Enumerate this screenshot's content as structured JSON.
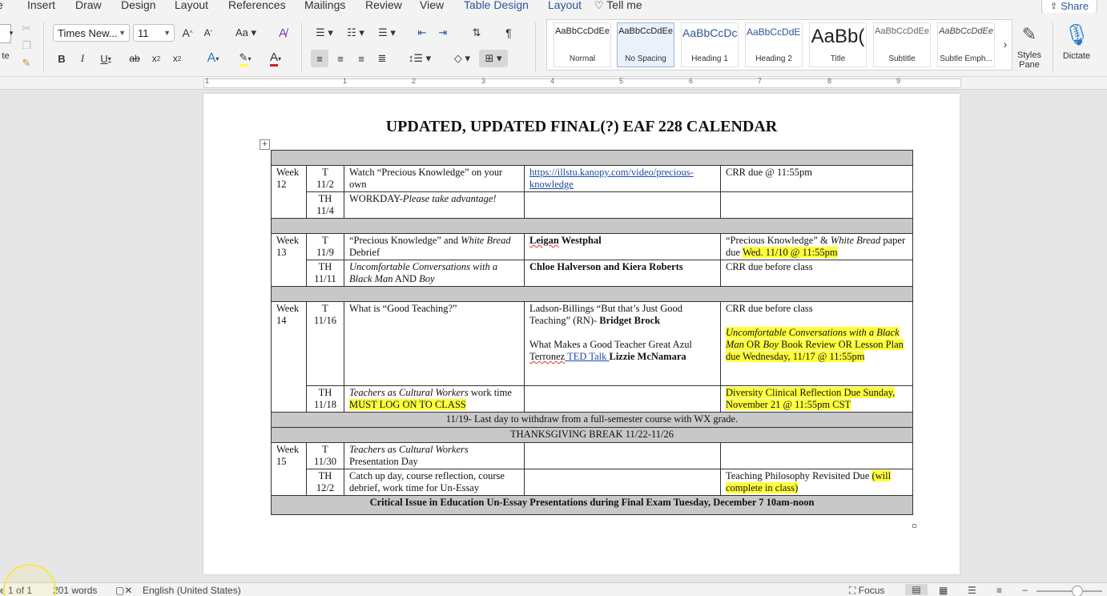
{
  "menu": {
    "tabs": [
      "e",
      "Insert",
      "Draw",
      "Design",
      "Layout",
      "References",
      "Mailings",
      "Review",
      "View",
      "Table Design",
      "Layout"
    ],
    "tell_me": "Tell me",
    "share": "Share"
  },
  "ribbon": {
    "font_name": "Times New...",
    "font_size": "11",
    "clipboard_label": "te",
    "styles": [
      {
        "preview": "AaBbCcDdEe",
        "name": "Normal"
      },
      {
        "preview": "AaBbCcDdEe",
        "name": "No Spacing"
      },
      {
        "preview": "AaBbCcDc",
        "name": "Heading 1"
      },
      {
        "preview": "AaBbCcDdEe",
        "name": "Heading 2"
      },
      {
        "preview": "AaBb(",
        "name": "Title"
      },
      {
        "preview": "AaBbCcDdEe",
        "name": "Subtitle"
      },
      {
        "preview": "AaBbCcDdEe",
        "name": "Subtle Emph..."
      }
    ],
    "styles_pane": "Styles Pane",
    "dictate": "Dictate"
  },
  "ruler": {
    "numbers": [
      "1",
      "1",
      "2",
      "3",
      "4",
      "5",
      "6",
      "7",
      "8",
      "9"
    ]
  },
  "document": {
    "title": "UPDATED, UPDATED FINAL(?) EAF 228 CALENDAR",
    "w12": {
      "week": "Week 12",
      "r1": {
        "day": "T",
        "date": "11/2",
        "topic": "Watch “Precious Knowledge” on your own",
        "link": "https://illstu.kanopy.com/video/precious-knowledge",
        "due": "CRR due @ 11:55pm"
      },
      "r2": {
        "day": "TH",
        "date": "11/4",
        "topic_a": "WORKDAY-",
        "topic_b": "Please take advantage!"
      }
    },
    "w13": {
      "week": "Week 13",
      "r1": {
        "day": "T",
        "date": "11/9",
        "topic_a": "“Precious Knowledge” and ",
        "topic_b": "White Bread",
        "topic_c": " Debrief",
        "reading_a": "Leigan",
        "reading_b": " Westphal",
        "due_a": "“Precious Knowledge” & ",
        "due_b": "White Bread",
        "due_c": " paper due ",
        "due_d": "Wed. 11/10 @ 11:55pm"
      },
      "r2": {
        "day": "TH",
        "date": "11/11",
        "topic_a": "Uncomfortable Conversations with a Black Man",
        "topic_b": " AND ",
        "topic_c": "Boy",
        "reading": "Chloe Halverson and Kiera Roberts",
        "due": "CRR due before class"
      }
    },
    "w14": {
      "week": "Week 14",
      "r1": {
        "day": "T",
        "date": "11/16",
        "topic": "What is “Good Teaching?”",
        "reading_a": "Ladson-Billings “But that’s Just Good Teaching” (RN)- ",
        "reading_b": "Bridget Brock",
        "reading_c": "What Makes a Good Teacher Great Azul ",
        "reading_d": "Terronez",
        "reading_e": " TED Talk ",
        "reading_f": "Lizzie McNamara",
        "due_a": "CRR due before class",
        "due_b": "Uncomfortable Conversations with a Black Man",
        "due_c": " OR ",
        "due_d": "Boy",
        "due_e": " Book Review OR Lesson Plan due Wednesday, 11/17 @ 11:55pm"
      },
      "r2": {
        "day": "TH",
        "date": "11/18",
        "topic_a": "Teachers as Cultural Workers",
        "topic_b": " work time ",
        "topic_c": "MUST LOG ON TO CLASS",
        "due": "Diversity Clinical Reflection Due Sunday, November 21 @ 11:55pm CST"
      }
    },
    "banner_withdraw": "11/19- Last day to withdraw from a full-semester course with WX grade.",
    "banner_break": "THANKSGIVING BREAK 11/22-11/26",
    "w15": {
      "week": "Week 15",
      "r1": {
        "day": "T",
        "date": "11/30",
        "topic_a": "Teachers as Cultural Workers",
        "topic_b": " Presentation Day"
      },
      "r2": {
        "day": "TH",
        "date": "12/2",
        "topic": "Catch up day, course reflection, course debrief, work time for Un-Essay",
        "due_a": "Teaching Philosophy Revisited Due ",
        "due_b": "(will complete in class)"
      }
    },
    "final": "Critical Issue in Education Un-Essay Presentations during Final Exam Tuesday, December 7 10am-noon"
  },
  "status": {
    "page": "e 1 of 1",
    "words": "201 words",
    "language": "English (United States)",
    "focus": "Focus"
  }
}
